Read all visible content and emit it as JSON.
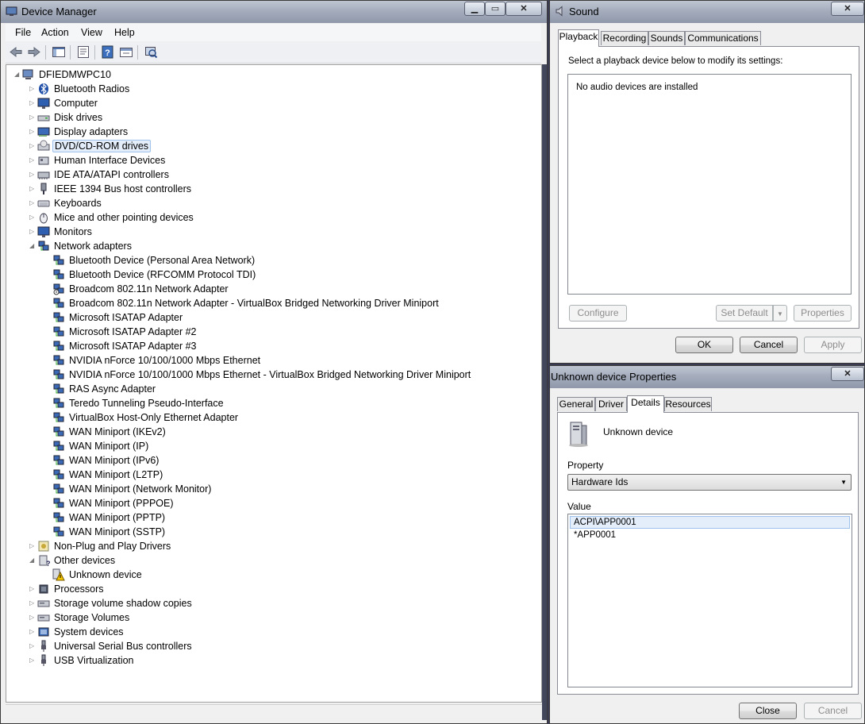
{
  "device_manager": {
    "title": "Device Manager",
    "menu": [
      "File",
      "Action",
      "View",
      "Help"
    ],
    "toolbar_icons": [
      "back-arrow-icon",
      "forward-arrow-icon",
      "show-hide-console-tree-icon",
      "properties-icon",
      "help-icon",
      "scan-hardware-changes-icon",
      "update-driver-icon"
    ],
    "tree": [
      {
        "label": "DFIEDMWPC10",
        "level": 0,
        "expander": "open",
        "icon": "computer-icon"
      },
      {
        "label": "Bluetooth Radios",
        "level": 1,
        "expander": "closed",
        "icon": "bluetooth-icon"
      },
      {
        "label": "Computer",
        "level": 1,
        "expander": "closed",
        "icon": "monitor-icon"
      },
      {
        "label": "Disk drives",
        "level": 1,
        "expander": "closed",
        "icon": "disk-drive-icon"
      },
      {
        "label": "Display adapters",
        "level": 1,
        "expander": "closed",
        "icon": "display-adapter-icon"
      },
      {
        "label": "DVD/CD-ROM drives",
        "level": 1,
        "expander": "closed",
        "icon": "dvd-drive-icon",
        "selected": true
      },
      {
        "label": "Human Interface Devices",
        "level": 1,
        "expander": "closed",
        "icon": "hid-icon"
      },
      {
        "label": "IDE ATA/ATAPI controllers",
        "level": 1,
        "expander": "closed",
        "icon": "ide-controller-icon"
      },
      {
        "label": "IEEE 1394 Bus host controllers",
        "level": 1,
        "expander": "closed",
        "icon": "firewire-icon"
      },
      {
        "label": "Keyboards",
        "level": 1,
        "expander": "closed",
        "icon": "keyboard-icon"
      },
      {
        "label": "Mice and other pointing devices",
        "level": 1,
        "expander": "closed",
        "icon": "mouse-icon"
      },
      {
        "label": "Monitors",
        "level": 1,
        "expander": "closed",
        "icon": "monitor-icon"
      },
      {
        "label": "Network adapters",
        "level": 1,
        "expander": "open",
        "icon": "network-adapter-icon"
      },
      {
        "label": "Bluetooth Device (Personal Area Network)",
        "level": 2,
        "icon": "network-adapter-icon"
      },
      {
        "label": "Bluetooth Device (RFCOMM Protocol TDI)",
        "level": 2,
        "icon": "network-adapter-icon"
      },
      {
        "label": "Broadcom 802.11n Network Adapter",
        "level": 2,
        "icon": "network-adapter-disabled-icon"
      },
      {
        "label": "Broadcom 802.11n Network Adapter - VirtualBox Bridged Networking Driver Miniport",
        "level": 2,
        "icon": "network-adapter-icon"
      },
      {
        "label": "Microsoft ISATAP Adapter",
        "level": 2,
        "icon": "network-adapter-icon"
      },
      {
        "label": "Microsoft ISATAP Adapter #2",
        "level": 2,
        "icon": "network-adapter-icon"
      },
      {
        "label": "Microsoft ISATAP Adapter #3",
        "level": 2,
        "icon": "network-adapter-icon"
      },
      {
        "label": "NVIDIA nForce 10/100/1000 Mbps Ethernet",
        "level": 2,
        "icon": "network-adapter-icon"
      },
      {
        "label": "NVIDIA nForce 10/100/1000 Mbps Ethernet  - VirtualBox Bridged Networking Driver Miniport",
        "level": 2,
        "icon": "network-adapter-icon"
      },
      {
        "label": "RAS Async Adapter",
        "level": 2,
        "icon": "network-adapter-icon"
      },
      {
        "label": "Teredo Tunneling Pseudo-Interface",
        "level": 2,
        "icon": "network-adapter-icon"
      },
      {
        "label": "VirtualBox Host-Only Ethernet Adapter",
        "level": 2,
        "icon": "network-adapter-icon"
      },
      {
        "label": "WAN Miniport (IKEv2)",
        "level": 2,
        "icon": "network-adapter-icon"
      },
      {
        "label": "WAN Miniport (IP)",
        "level": 2,
        "icon": "network-adapter-icon"
      },
      {
        "label": "WAN Miniport (IPv6)",
        "level": 2,
        "icon": "network-adapter-icon"
      },
      {
        "label": "WAN Miniport (L2TP)",
        "level": 2,
        "icon": "network-adapter-icon"
      },
      {
        "label": "WAN Miniport (Network Monitor)",
        "level": 2,
        "icon": "network-adapter-icon"
      },
      {
        "label": "WAN Miniport (PPPOE)",
        "level": 2,
        "icon": "network-adapter-icon"
      },
      {
        "label": "WAN Miniport (PPTP)",
        "level": 2,
        "icon": "network-adapter-icon"
      },
      {
        "label": "WAN Miniport (SSTP)",
        "level": 2,
        "icon": "network-adapter-icon"
      },
      {
        "label": "Non-Plug and Play Drivers",
        "level": 1,
        "expander": "closed",
        "icon": "non-pnp-driver-icon"
      },
      {
        "label": "Other devices",
        "level": 1,
        "expander": "open",
        "icon": "unknown-device-icon"
      },
      {
        "label": "Unknown device",
        "level": 2,
        "icon": "warning-device-icon"
      },
      {
        "label": "Processors",
        "level": 1,
        "expander": "closed",
        "icon": "processor-icon"
      },
      {
        "label": "Storage volume shadow copies",
        "level": 1,
        "expander": "closed",
        "icon": "storage-icon"
      },
      {
        "label": "Storage Volumes",
        "level": 1,
        "expander": "closed",
        "icon": "storage-icon"
      },
      {
        "label": "System devices",
        "level": 1,
        "expander": "closed",
        "icon": "system-device-icon"
      },
      {
        "label": "Universal Serial Bus controllers",
        "level": 1,
        "expander": "closed",
        "icon": "usb-icon"
      },
      {
        "label": "USB Virtualization",
        "level": 1,
        "expander": "closed",
        "icon": "usb-icon"
      }
    ]
  },
  "sound": {
    "title": "Sound",
    "tabs": [
      "Playback",
      "Recording",
      "Sounds",
      "Communications"
    ],
    "active_tab": "Playback",
    "instruction": "Select a playback device below to modify its settings:",
    "empty_message": "No audio devices are installed",
    "buttons": {
      "configure": "Configure",
      "set_default": "Set Default",
      "properties": "Properties",
      "ok": "OK",
      "cancel": "Cancel",
      "apply": "Apply"
    }
  },
  "properties": {
    "title": "Unknown device Properties",
    "tabs": [
      "General",
      "Driver",
      "Details",
      "Resources"
    ],
    "active_tab": "Details",
    "device_name": "Unknown device",
    "property_label": "Property",
    "property_value": "Hardware Ids",
    "value_label": "Value",
    "values": [
      "ACPI\\APP0001",
      "*APP0001"
    ],
    "buttons": {
      "close": "Close",
      "cancel": "Cancel"
    }
  },
  "colors": {
    "titlebar": "#a5adbd",
    "window_bg": "#f0f0f0",
    "selection": "#e4eefb",
    "selection_border": "#9ec2ec"
  }
}
